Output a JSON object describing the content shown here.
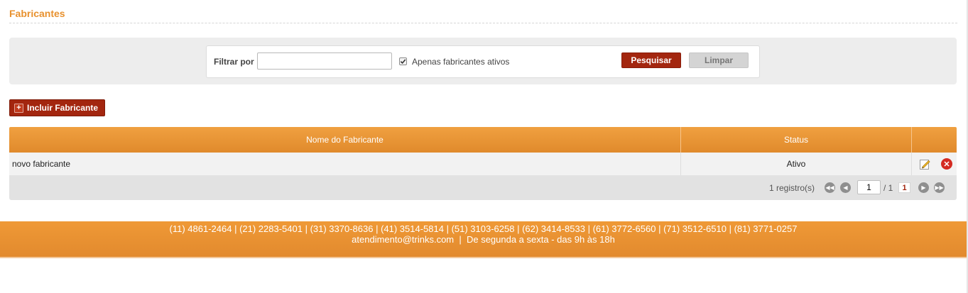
{
  "page": {
    "title": "Fabricantes"
  },
  "filter": {
    "label": "Filtrar por",
    "input_value": "",
    "only_active_checked": true,
    "only_active_label": "Apenas fabricantes ativos",
    "search_label": "Pesquisar",
    "clear_label": "Limpar"
  },
  "actions": {
    "add_label": "Incluir Fabricante",
    "add_icon": "+"
  },
  "table": {
    "columns": [
      "Nome do Fabricante",
      "Status",
      ""
    ],
    "rows": [
      {
        "name": "novo fabricante",
        "status": "Ativo"
      }
    ]
  },
  "pager": {
    "count": "1 registro(s)",
    "current_page": "1",
    "total": "/ 1",
    "page_link": "1"
  },
  "footer": {
    "phones": "(11) 4861-2464 | (21) 2283-5401 | (31) 3370-8636 | (41) 3514-5814 | (51) 3103-6258 | (62) 3414-8533 | (61) 3772-6560 | (71) 3512-6510 | (81) 3771-0257",
    "contact": "atendimento@trinks.com  |  De segunda a sexta - das 9h às 18h"
  },
  "colors": {
    "accent": "#e8912e",
    "primary_button": "#a3260f",
    "header_orange": "#ef9936"
  }
}
